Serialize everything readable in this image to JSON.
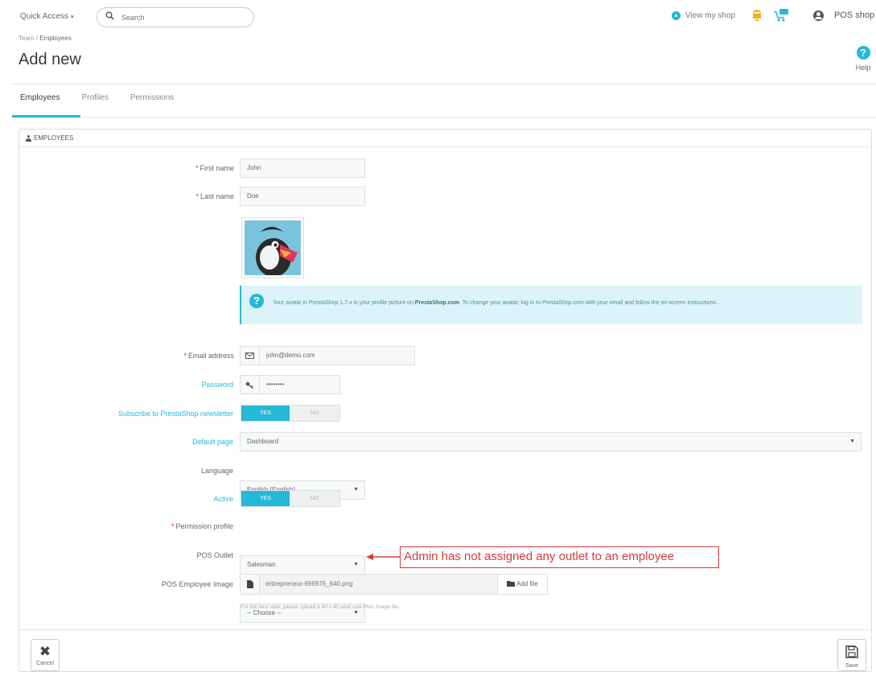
{
  "topbar": {
    "quick_access_label": "Quick Access",
    "quick_access_caret": "▾",
    "search_placeholder": "Search",
    "view_shop_label": "View my shop",
    "shop_name": "POS shop"
  },
  "breadcrumb": {
    "parent": "Team",
    "separator": "/",
    "current": "Employees"
  },
  "page_title": "Add new",
  "help": {
    "icon": "?",
    "label": "Help"
  },
  "tabs": [
    {
      "label": "Employees",
      "active": true
    },
    {
      "label": "Profiles",
      "active": false
    },
    {
      "label": "Permissions",
      "active": false
    }
  ],
  "panel": {
    "heading": "EMPLOYEES"
  },
  "form": {
    "first_name": {
      "label": "First name",
      "required": "*",
      "value": "John"
    },
    "last_name": {
      "label": "Last name",
      "required": "*",
      "value": "Doe"
    },
    "avatar_alert": {
      "text_before": "Your avatar in PrestaShop 1.7.x is your profile picture on ",
      "link": "PrestaShop.com",
      "text_after": ". To change your avatar, log in to PrestaShop.com with your email and follow the on-screen instructions."
    },
    "email": {
      "label": "Email address",
      "required": "*",
      "value": "john@demo.com"
    },
    "password": {
      "label": "Password",
      "value": "••••••••"
    },
    "newsletter": {
      "label": "Subscribe to PrestaShop newsletter",
      "yes": "YES",
      "no": "NO",
      "selected": "YES"
    },
    "default_page": {
      "label": "Default page",
      "value": "Dashboard"
    },
    "language": {
      "label": "Language",
      "value": "English (English)"
    },
    "active": {
      "label": "Active",
      "yes": "YES",
      "no": "NO",
      "selected": "YES"
    },
    "permission_profile": {
      "label": "Permission profile",
      "required": "*",
      "value": "Salesman"
    },
    "pos_outlet": {
      "label": "POS Outlet",
      "value": "-- Choose --"
    },
    "pos_employee_image": {
      "label": "POS Employee Image",
      "file_name": "entrepreneur-696976_640.png",
      "add_file_label": "Add file",
      "help_text": "For the best view, please upload a 40 x 40 pixel size PNG image file."
    }
  },
  "annotation": {
    "text": "Admin has not assigned any outlet to an employee"
  },
  "footer": {
    "cancel_label": "Cancel",
    "save_label": "Save"
  },
  "colors": {
    "accent": "#25b9d7",
    "required": "#e22333",
    "annotation": "#d63b3b"
  },
  "icons": {
    "search": "search-icon",
    "view_shop": "eye-icon",
    "notifications": "bell-icon",
    "orders": "cart-icon",
    "user": "user-icon",
    "help": "help-icon",
    "employees": "person-icon",
    "info": "question-icon",
    "email": "envelope-icon",
    "password": "key-icon",
    "file": "file-icon",
    "folder": "folder-icon",
    "cancel": "close-icon",
    "save": "floppy-icon"
  }
}
